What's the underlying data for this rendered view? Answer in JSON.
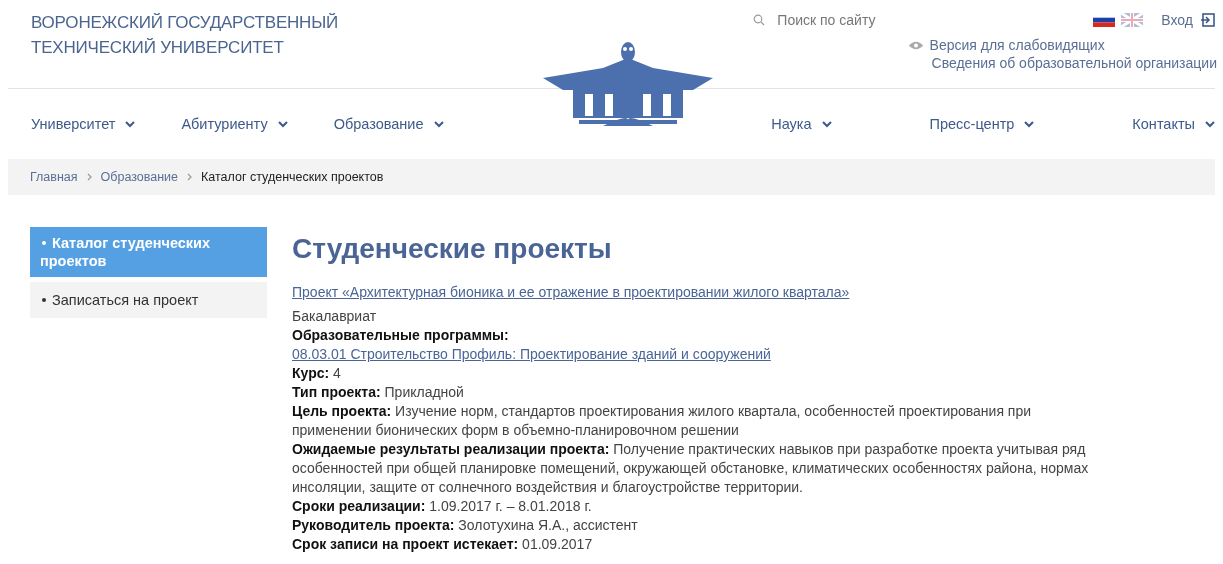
{
  "header": {
    "university_name": [
      "ВОРОНЕЖСКИЙ ГОСУДАРСТВЕННЫЙ",
      "ТЕХНИЧЕСКИЙ УНИВЕРСИТЕТ"
    ],
    "search": {
      "placeholder": "Поиск по сайту"
    },
    "languages": [
      {
        "kind": "ru",
        "selected": true
      },
      {
        "kind": "en",
        "selected": false
      }
    ],
    "login": "Вход",
    "accessibility_link": "Версия для слабовидящих",
    "org_info_link": "Сведения об образовательной организации"
  },
  "nav": {
    "left": [
      "Университет",
      "Абитуриенту",
      "Образование"
    ],
    "right": [
      "Наука",
      "Пресс-центр",
      "Контакты"
    ]
  },
  "breadcrumbs": [
    {
      "label": "Главная",
      "kind": "link"
    },
    {
      "label": "Образование",
      "kind": "link"
    },
    {
      "label": "Каталог студенческих проектов",
      "kind": "current"
    }
  ],
  "sidebar": {
    "items": [
      {
        "label": "Каталог студенческих проектов",
        "selected": true
      },
      {
        "label": "Записаться на проект",
        "selected": false
      }
    ]
  },
  "content": {
    "title": "Студенческие проекты",
    "project_link": "Проект «Архитектурная бионика и ее отражение в проектировании жилого квартала»",
    "details": [
      {
        "kind": "text",
        "value": "Бакалавриат"
      },
      {
        "kind": "label",
        "label": "Образовательные программы:"
      },
      {
        "kind": "link",
        "value": "08.03.01 Строительство Профиль: Проектирование зданий и сооружений"
      },
      {
        "kind": "field",
        "text": "**Курс:** 4"
      },
      {
        "kind": "field",
        "text": "**Тип проекта:** Прикладной"
      },
      {
        "kind": "field",
        "text": "**Цель проекта:** Изучение норм, стандартов проектирования жилого квартала, особенностей проектирования при применении бионических форм в объемно-планировочном решении"
      },
      {
        "kind": "field",
        "text": "**Ожидаемые результаты реализации проекта:** Получение практических навыков при разработке проекта учитывая ряд особенностей при общей планировке помещений, окружающей обстановке, климатических особенностях района, нормах инсоляции, защите от солнечного воздействия и благоустройстве территории."
      },
      {
        "kind": "field",
        "text": "**Сроки реализации:** 1.09.2017 г. – 8.01.2018 г."
      },
      {
        "kind": "field",
        "text": "**Руководитель проекта:** Золотухина Я.А., ассистент"
      },
      {
        "kind": "field",
        "text": "**Срок записи на проект истекает:** 01.09.2017"
      }
    ]
  }
}
